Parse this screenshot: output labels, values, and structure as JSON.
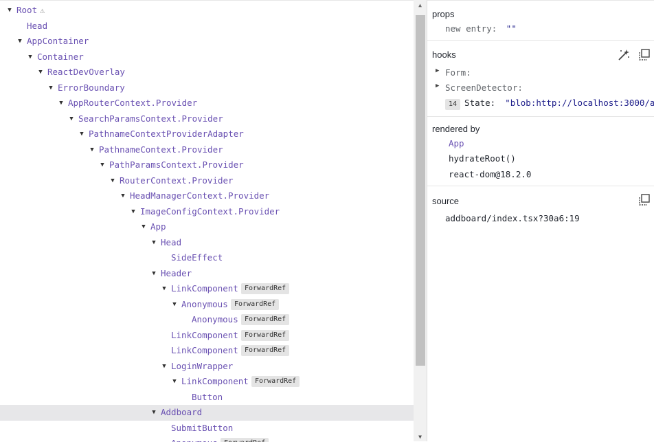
{
  "tree": {
    "rows": [
      {
        "label": "Root",
        "depth": 0,
        "arrow": true,
        "warning": true
      },
      {
        "label": "Head",
        "depth": 1,
        "arrow": false
      },
      {
        "label": "AppContainer",
        "depth": 1,
        "arrow": true
      },
      {
        "label": "Container",
        "depth": 2,
        "arrow": true
      },
      {
        "label": "ReactDevOverlay",
        "depth": 3,
        "arrow": true
      },
      {
        "label": "ErrorBoundary",
        "depth": 4,
        "arrow": true
      },
      {
        "label": "AppRouterContext.Provider",
        "depth": 5,
        "arrow": true
      },
      {
        "label": "SearchParamsContext.Provider",
        "depth": 6,
        "arrow": true
      },
      {
        "label": "PathnameContextProviderAdapter",
        "depth": 7,
        "arrow": true
      },
      {
        "label": "PathnameContext.Provider",
        "depth": 8,
        "arrow": true
      },
      {
        "label": "PathParamsContext.Provider",
        "depth": 9,
        "arrow": true
      },
      {
        "label": "RouterContext.Provider",
        "depth": 10,
        "arrow": true
      },
      {
        "label": "HeadManagerContext.Provider",
        "depth": 11,
        "arrow": true
      },
      {
        "label": "ImageConfigContext.Provider",
        "depth": 12,
        "arrow": true
      },
      {
        "label": "App",
        "depth": 13,
        "arrow": true
      },
      {
        "label": "Head",
        "depth": 14,
        "arrow": true
      },
      {
        "label": "SideEffect",
        "depth": 15,
        "arrow": false
      },
      {
        "label": "Header",
        "depth": 14,
        "arrow": true
      },
      {
        "label": "LinkComponent",
        "depth": 15,
        "arrow": true,
        "badge": "ForwardRef"
      },
      {
        "label": "Anonymous",
        "depth": 16,
        "arrow": true,
        "badge": "ForwardRef"
      },
      {
        "label": "Anonymous",
        "depth": 17,
        "arrow": false,
        "badge": "ForwardRef"
      },
      {
        "label": "LinkComponent",
        "depth": 15,
        "arrow": false,
        "badge": "ForwardRef"
      },
      {
        "label": "LinkComponent",
        "depth": 15,
        "arrow": false,
        "badge": "ForwardRef"
      },
      {
        "label": "LoginWrapper",
        "depth": 15,
        "arrow": true
      },
      {
        "label": "LinkComponent",
        "depth": 16,
        "arrow": true,
        "badge": "ForwardRef"
      },
      {
        "label": "Button",
        "depth": 17,
        "arrow": false
      },
      {
        "label": "Addboard",
        "depth": 14,
        "arrow": true,
        "selected": true
      },
      {
        "label": "SubmitButton",
        "depth": 15,
        "arrow": false
      },
      {
        "label": "Anonymous",
        "depth": 15,
        "arrow": false,
        "badge": "ForwardRef"
      }
    ]
  },
  "props": {
    "title": "props",
    "entry_key": "new entry:",
    "entry_value": "\"\""
  },
  "hooks": {
    "title": "hooks",
    "form_label": "Form:",
    "screen_label": "ScreenDetector:",
    "state_index": "14",
    "state_key": "State:",
    "state_value": "\"blob:http://localhost:3000/a"
  },
  "rendered_by": {
    "title": "rendered by",
    "items": [
      "App",
      "hydrateRoot()",
      "react-dom@18.2.0"
    ]
  },
  "source": {
    "title": "source",
    "file": "addboard/index.tsx?30a6:19"
  },
  "icons": {
    "warning": "warning-icon",
    "wand": "magic-wand-icon",
    "copy": "copy-icon"
  },
  "colors": {
    "component_name": "#6a51b2",
    "selected_row": "#e7e7e9",
    "string_value": "#1d1d8a"
  }
}
